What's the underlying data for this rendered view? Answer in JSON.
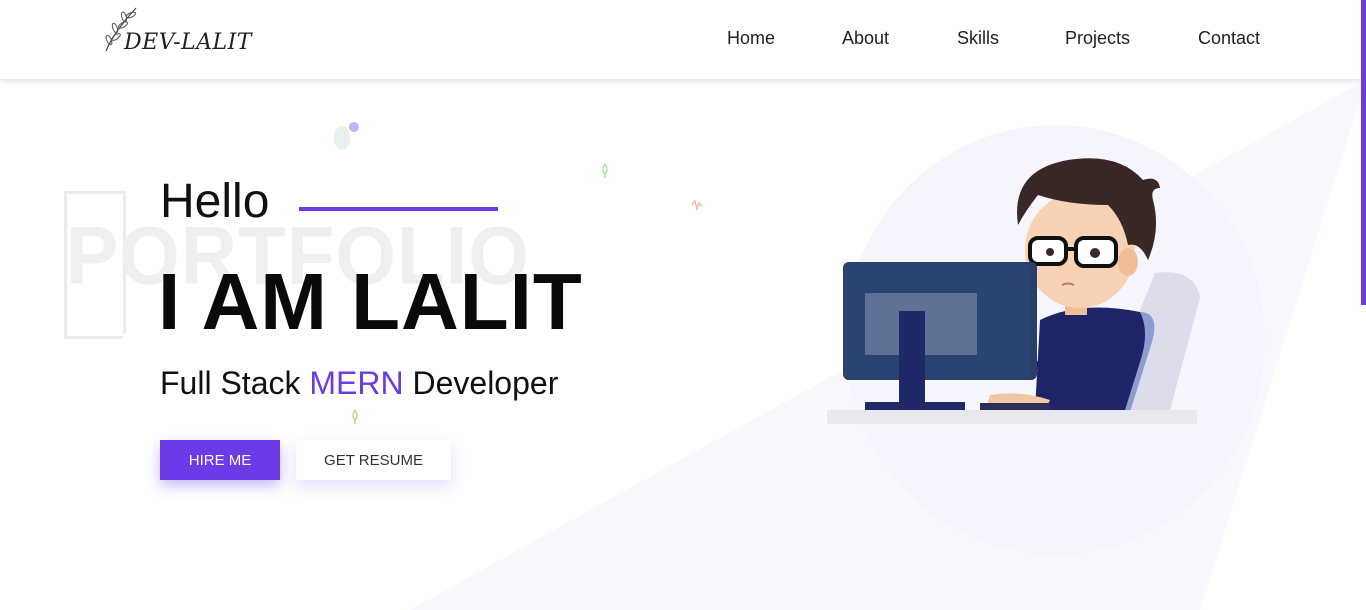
{
  "brand": {
    "logo_text": "DEV-LALIT"
  },
  "nav": {
    "items": [
      {
        "label": "Home"
      },
      {
        "label": "About"
      },
      {
        "label": "Skills"
      },
      {
        "label": "Projects"
      },
      {
        "label": "Contact"
      }
    ]
  },
  "hero": {
    "watermark": "PORTFOLIO",
    "greeting": "Hello",
    "title": "I AM LALIT",
    "subtitle_before": "Full Stack ",
    "subtitle_accent": "MERN",
    "subtitle_after": " Developer",
    "hire_button": "HIRE ME",
    "resume_button": "GET RESUME"
  },
  "colors": {
    "accent": "#6c3ae6",
    "background_shape": "#f9f8fe"
  },
  "illustration": {
    "icon": "developer-at-computer-illustration"
  }
}
